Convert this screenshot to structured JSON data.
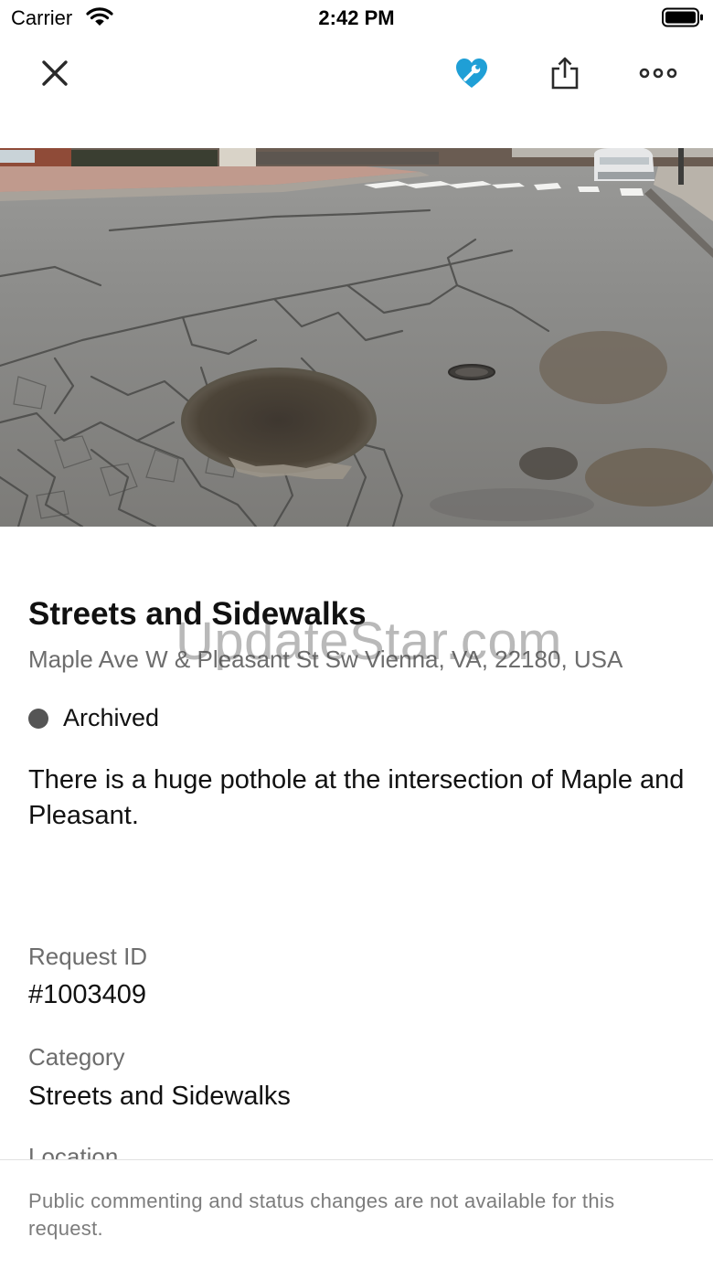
{
  "status_bar": {
    "carrier": "Carrier",
    "time": "2:42 PM",
    "wifi_icon": "wifi-icon",
    "battery_icon": "battery-icon"
  },
  "nav": {
    "close_icon": "close-icon",
    "favorite_icon": "heart-wrench-icon",
    "share_icon": "share-icon",
    "more_icon": "more-icon",
    "accent_color": "#1f9fd6"
  },
  "request": {
    "photo": "pothole-photo",
    "title": "Streets and Sidewalks",
    "address": "Maple Ave W & Pleasant St Sw Vienna, VA, 22180, USA",
    "status": "Archived",
    "status_color": "#555555",
    "description": "There is a huge pothole at the intersection of Maple and Pleasant."
  },
  "watermark": "UpdateStar.com",
  "details": {
    "request_id_label": "Request ID",
    "request_id_value": "#1003409",
    "category_label": "Category",
    "category_value": "Streets and Sidewalks",
    "location_label": "Location"
  },
  "footer": {
    "notice": "Public commenting and status changes are not available for this request."
  }
}
